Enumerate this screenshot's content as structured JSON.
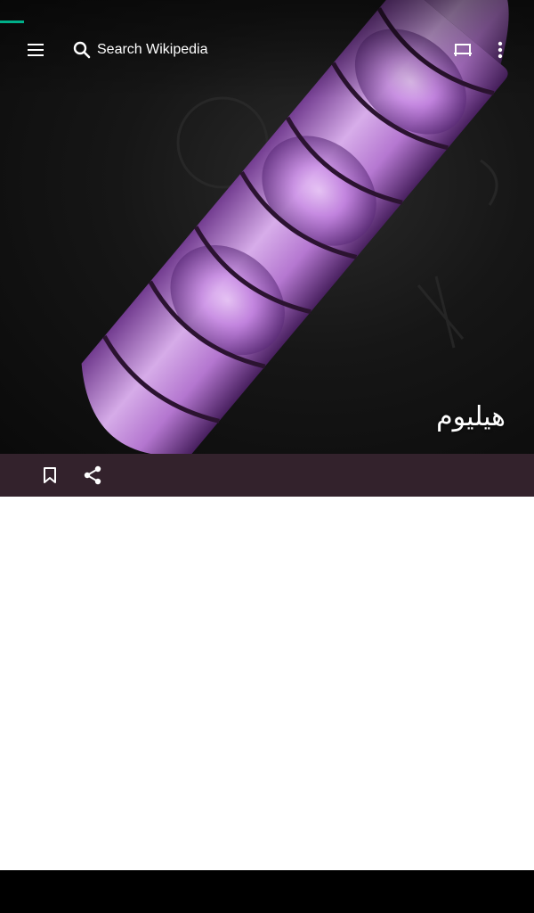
{
  "toolbar": {
    "menu_icon": "menu-icon",
    "search_icon": "search-icon",
    "search_label": "Search Wikipedia",
    "tabs_icon": "tabs-icon",
    "overflow_icon": "overflow-menu-icon"
  },
  "article": {
    "title": "هيليوم"
  },
  "actions": {
    "bookmark_icon": "bookmark-icon",
    "share_icon": "share-icon"
  },
  "colors": {
    "progress_accent": "#00af89",
    "action_bar": "#33222c",
    "tube_glow": "#c98ae6"
  }
}
